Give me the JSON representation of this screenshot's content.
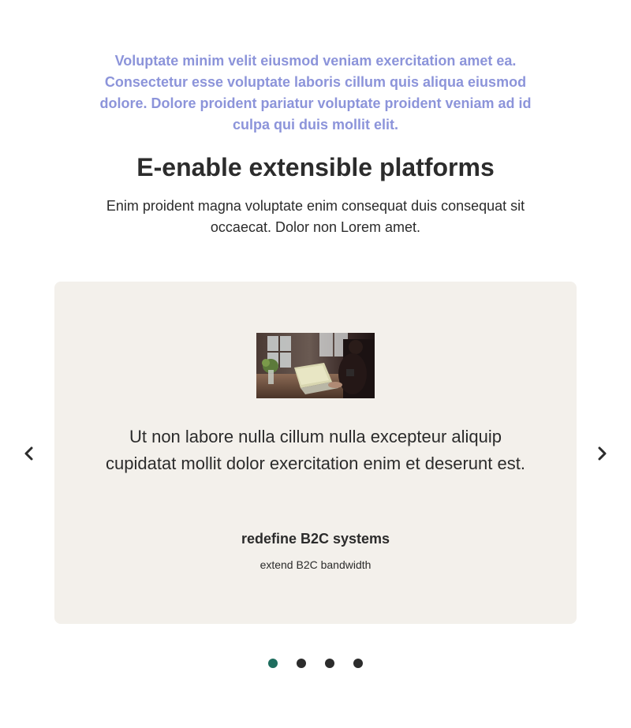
{
  "intro": {
    "eyebrow": "Voluptate minim velit eiusmod veniam exercitation amet ea. Consectetur esse voluptate laboris cillum quis aliqua eiusmod dolore. Dolore proident pariatur voluptate proident veniam ad id culpa qui duis mollit elit.",
    "headline": "E-enable extensible platforms",
    "lead": "Enim proident magna voluptate enim consequat duis consequat sit occaecat. Dolor non Lorem amet."
  },
  "testimonial": {
    "photo_icon": "laptop-workspace-photo",
    "quote": "Ut non labore nulla cillum nulla excepteur aliquip cupidatat mollit dolor exercitation enim et deserunt est.",
    "author": "redefine B2C systems",
    "role": "extend B2C bandwidth"
  },
  "carousel": {
    "prev_icon": "chevron-left-icon",
    "next_icon": "chevron-right-icon",
    "total_slides": 4,
    "active_slide": 1
  },
  "colors": {
    "eyebrow": "#8c94da",
    "card_background": "#f3f0eb",
    "dot_active": "#1e6d5e",
    "dot_inactive": "#2c2c2c",
    "text": "#2b2b2b"
  }
}
